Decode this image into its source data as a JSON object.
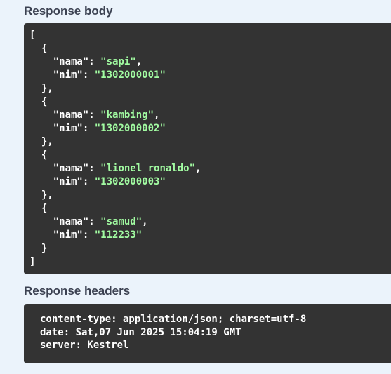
{
  "response_body": {
    "title": "Response body",
    "open_bracket": "[",
    "close_bracket": "]",
    "items": [
      {
        "nama": "\"sapi\"",
        "nim": "\"1302000001\""
      },
      {
        "nama": "\"kambing\"",
        "nim": "\"1302000002\""
      },
      {
        "nama": "\"lionel ronaldo\"",
        "nim": "\"1302000003\""
      },
      {
        "nama": "\"samud\"",
        "nim": "\"112233\""
      }
    ],
    "key_nama": "\"nama\"",
    "key_nim": "\"nim\""
  },
  "response_headers": {
    "title": "Response headers",
    "lines": [
      "content-type: application/json; charset=utf-8",
      "date: Sat,07 Jun 2025 15:04:19 GMT",
      "server: Kestrel"
    ]
  },
  "colors": {
    "background": "#ebf3fb",
    "code_background": "#333333",
    "string_color": "#a2fca2",
    "title_color": "#3b4151"
  }
}
